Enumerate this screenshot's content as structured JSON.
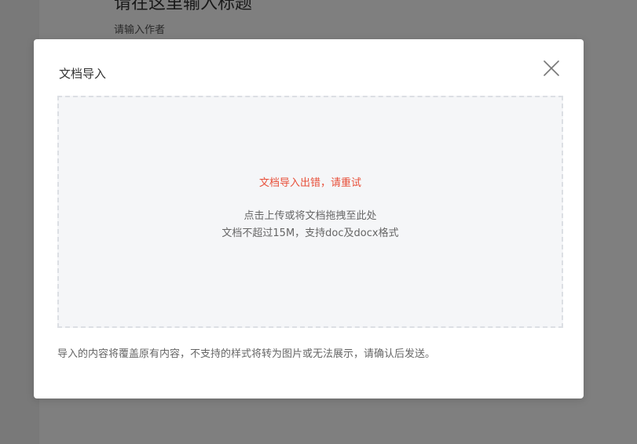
{
  "editor": {
    "title_placeholder": "请在这里输入标题",
    "author_placeholder": "请输入作者"
  },
  "modal": {
    "title": "文档导入",
    "close_icon": "close-icon",
    "dropzone": {
      "error_text": "文档导入出错，请重试",
      "hint_line1": "点击上传或将文档拖拽至此处",
      "hint_line2": "文档不超过15M，支持doc及docx格式"
    },
    "notice": "导入的内容将覆盖原有内容，不支持的样式将转为图片或无法展示，请确认后发送。"
  },
  "colors": {
    "error": "#e8503a",
    "overlay": "rgba(0,0,0,0.5)",
    "dropzone_bg": "#f5f6f8",
    "dropzone_border": "#dcdfe4"
  }
}
